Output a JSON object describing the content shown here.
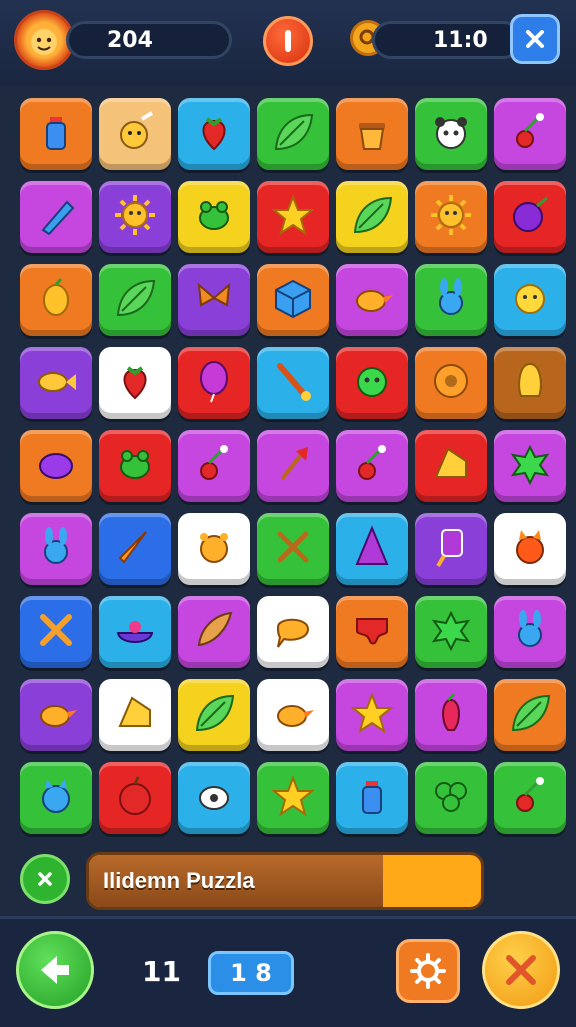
{
  "header": {
    "score": "204",
    "timer": "11:0",
    "avatar_icon": "lion-face-icon",
    "center_icon": "info-icon",
    "coin_icon": "coin-icon",
    "close_icon": "close-icon"
  },
  "board": {
    "rows": 9,
    "cols": 7,
    "tiles": [
      {
        "color": "#f07a22",
        "icon": "bottle-icon"
      },
      {
        "color": "#f5c27a",
        "icon": "snail-icon"
      },
      {
        "color": "#2bb0ea",
        "icon": "strawberry-icon"
      },
      {
        "color": "#35c23a",
        "icon": "leaf-icon"
      },
      {
        "color": "#f07a22",
        "icon": "pot-icon"
      },
      {
        "color": "#35c23a",
        "icon": "panda-icon"
      },
      {
        "color": "#c646e0",
        "icon": "cherry-icon"
      },
      {
        "color": "#c646e0",
        "icon": "pencil-icon"
      },
      {
        "color": "#8a3fd8",
        "icon": "sun-face-icon"
      },
      {
        "color": "#f5d21e",
        "icon": "frog-icon"
      },
      {
        "color": "#e62525",
        "icon": "star-icon"
      },
      {
        "color": "#f5d21e",
        "icon": "leaf-icon"
      },
      {
        "color": "#f07a22",
        "icon": "sun-face-icon"
      },
      {
        "color": "#e62525",
        "icon": "plum-icon"
      },
      {
        "color": "#f07a22",
        "icon": "mango-icon"
      },
      {
        "color": "#35c23a",
        "icon": "leaf-icon"
      },
      {
        "color": "#8a3fd8",
        "icon": "butterfly-icon"
      },
      {
        "color": "#f07a22",
        "icon": "cube-icon"
      },
      {
        "color": "#c646e0",
        "icon": "bird-icon"
      },
      {
        "color": "#35c23a",
        "icon": "bunny-icon"
      },
      {
        "color": "#2bb0ea",
        "icon": "chick-icon"
      },
      {
        "color": "#8a3fd8",
        "icon": "fish-icon"
      },
      {
        "color": "#ffffff",
        "icon": "strawberry-icon"
      },
      {
        "color": "#e62525",
        "icon": "balloon-icon"
      },
      {
        "color": "#2bb0ea",
        "icon": "brush-icon"
      },
      {
        "color": "#e62525",
        "icon": "monster-icon"
      },
      {
        "color": "#f07a22",
        "icon": "donut-icon"
      },
      {
        "color": "#b8661e",
        "icon": "gem-icon"
      },
      {
        "color": "#f07a22",
        "icon": "blob-icon"
      },
      {
        "color": "#e62525",
        "icon": "frog-icon"
      },
      {
        "color": "#c646e0",
        "icon": "cherry-icon"
      },
      {
        "color": "#c646e0",
        "icon": "axe-icon"
      },
      {
        "color": "#c646e0",
        "icon": "cherry-icon"
      },
      {
        "color": "#e62525",
        "icon": "cheese-icon"
      },
      {
        "color": "#c646e0",
        "icon": "splat-icon"
      },
      {
        "color": "#c646e0",
        "icon": "bunny-icon"
      },
      {
        "color": "#2b6ee8",
        "icon": "carrot-icon"
      },
      {
        "color": "#ffffff",
        "icon": "bear-face-icon"
      },
      {
        "color": "#35c23a",
        "icon": "crossed-sticks-icon"
      },
      {
        "color": "#2bb0ea",
        "icon": "hat-icon"
      },
      {
        "color": "#8a3fd8",
        "icon": "popsicle-icon"
      },
      {
        "color": "#ffffff",
        "icon": "fox-face-icon"
      },
      {
        "color": "#2b6ee8",
        "icon": "crossed-tools-icon"
      },
      {
        "color": "#2bb0ea",
        "icon": "bowl-icon"
      },
      {
        "color": "#c646e0",
        "icon": "feather-icon"
      },
      {
        "color": "#ffffff",
        "icon": "bubble-icon"
      },
      {
        "color": "#f07a22",
        "icon": "drip-icon"
      },
      {
        "color": "#35c23a",
        "icon": "splat-icon"
      },
      {
        "color": "#c646e0",
        "icon": "bunny-icon"
      },
      {
        "color": "#8a3fd8",
        "icon": "bird-icon"
      },
      {
        "color": "#ffffff",
        "icon": "cheese-icon"
      },
      {
        "color": "#f5d21e",
        "icon": "leaf-icon"
      },
      {
        "color": "#ffffff",
        "icon": "bird-icon"
      },
      {
        "color": "#c646e0",
        "icon": "star-icon"
      },
      {
        "color": "#c646e0",
        "icon": "pepper-icon"
      },
      {
        "color": "#f07a22",
        "icon": "leaf-icon"
      },
      {
        "color": "#35c23a",
        "icon": "cat-icon"
      },
      {
        "color": "#e62525",
        "icon": "apple-icon"
      },
      {
        "color": "#2bb0ea",
        "icon": "egg-icon"
      },
      {
        "color": "#35c23a",
        "icon": "star-icon"
      },
      {
        "color": "#2bb0ea",
        "icon": "bottle-icon"
      },
      {
        "color": "#35c23a",
        "icon": "clover-icon"
      },
      {
        "color": "#35c23a",
        "icon": "cherry-icon"
      }
    ]
  },
  "status": {
    "label": "Ilidemn Puzzla",
    "progress": 0.75,
    "close_icon": "close-icon"
  },
  "footer": {
    "moves_count": "11",
    "level_value": "1 8",
    "back_icon": "back-arrow-icon",
    "settings_icon": "gear-icon",
    "shuffle_icon": "crossed-sticks-icon"
  }
}
